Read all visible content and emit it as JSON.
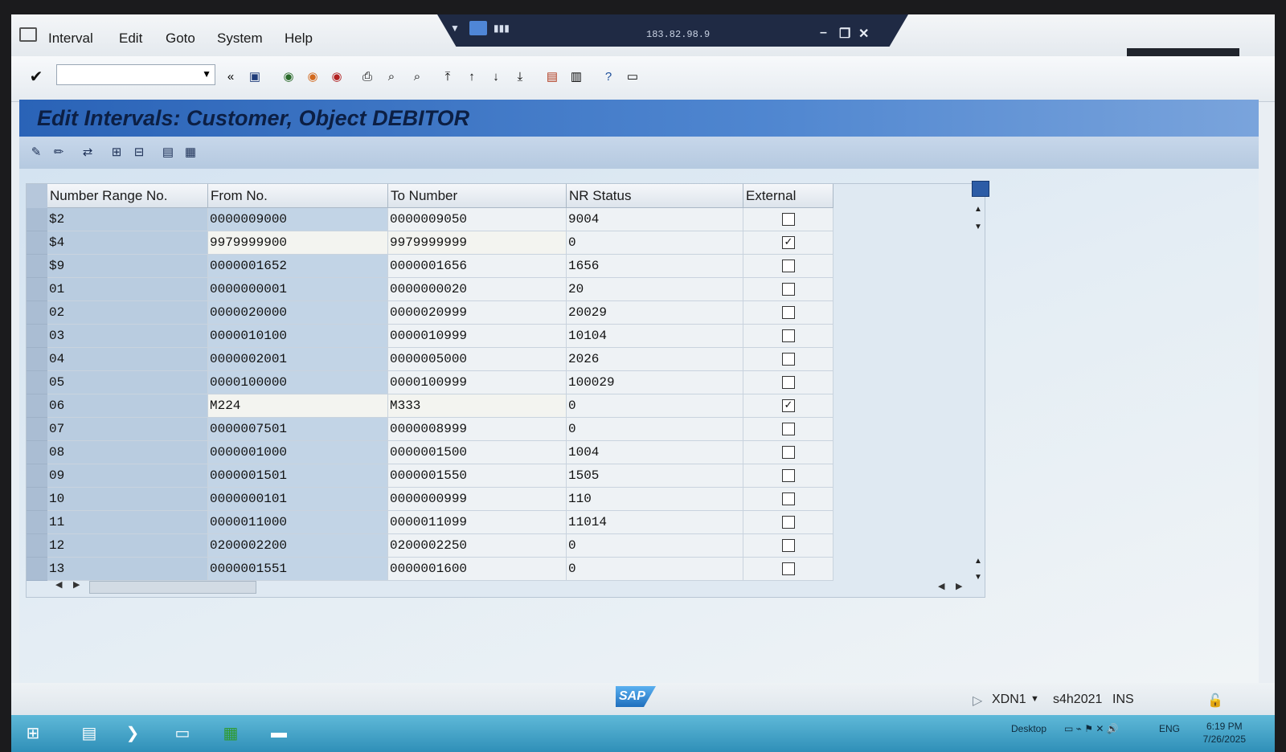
{
  "menu": {
    "items": [
      "Interval",
      "Edit",
      "Goto",
      "System",
      "Help"
    ]
  },
  "remote": {
    "ip": "183.82.98.9"
  },
  "toolbar": {
    "command_value": ""
  },
  "title": "Edit Intervals: Customer, Object DEBITOR",
  "table": {
    "headers": [
      "Number Range No.",
      "From No.",
      "To Number",
      "NR Status",
      "External"
    ],
    "rows": [
      {
        "nr": "$2",
        "from": "0000009000",
        "to": "0000009050",
        "status": "9004",
        "external": false
      },
      {
        "nr": "$4",
        "from": "9979999900",
        "to": "9979999999",
        "status": "0",
        "external": true
      },
      {
        "nr": "$9",
        "from": "0000001652",
        "to": "0000001656",
        "status": "1656",
        "external": false
      },
      {
        "nr": "01",
        "from": "0000000001",
        "to": "0000000020",
        "status": "20",
        "external": false
      },
      {
        "nr": "02",
        "from": "0000020000",
        "to": "0000020999",
        "status": "20029",
        "external": false
      },
      {
        "nr": "03",
        "from": "0000010100",
        "to": "0000010999",
        "status": "10104",
        "external": false
      },
      {
        "nr": "04",
        "from": "0000002001",
        "to": "0000005000",
        "status": "2026",
        "external": false
      },
      {
        "nr": "05",
        "from": "0000100000",
        "to": "0000100999",
        "status": "100029",
        "external": false
      },
      {
        "nr": "06",
        "from": "M224",
        "to": "M333",
        "status": "0",
        "external": true
      },
      {
        "nr": "07",
        "from": "0000007501",
        "to": "0000008999",
        "status": "0",
        "external": false
      },
      {
        "nr": "08",
        "from": "0000001000",
        "to": "0000001500",
        "status": "1004",
        "external": false
      },
      {
        "nr": "09",
        "from": "0000001501",
        "to": "0000001550",
        "status": "1505",
        "external": false
      },
      {
        "nr": "10",
        "from": "0000000101",
        "to": "0000000999",
        "status": "110",
        "external": false
      },
      {
        "nr": "11",
        "from": "0000011000",
        "to": "0000011099",
        "status": "11014",
        "external": false
      },
      {
        "nr": "12",
        "from": "0200002200",
        "to": "0200002250",
        "status": "0",
        "external": false
      },
      {
        "nr": "13",
        "from": "0000001551",
        "to": "0000001600",
        "status": "0",
        "external": false
      }
    ]
  },
  "status": {
    "logo": "SAP",
    "system": "XDN1",
    "server": "s4h2021",
    "mode": "INS"
  },
  "taskbar": {
    "desktop_label": "Desktop",
    "lang": "ENG",
    "time": "6:19 PM",
    "date": "7/26/2025"
  }
}
